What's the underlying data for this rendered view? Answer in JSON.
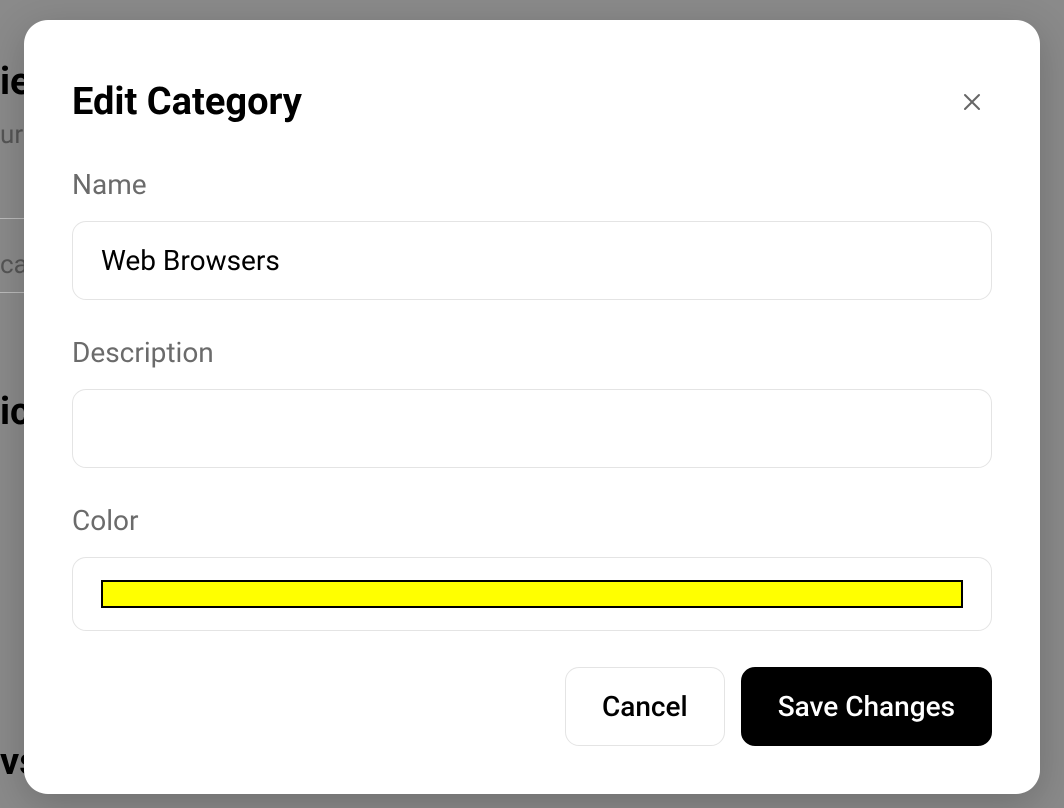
{
  "modal": {
    "title": "Edit Category",
    "labels": {
      "name": "Name",
      "description": "Description",
      "color": "Color"
    },
    "values": {
      "name": "Web Browsers",
      "description": "",
      "color": "#ffff00"
    },
    "buttons": {
      "cancel": "Cancel",
      "save": "Save Changes"
    }
  },
  "backdrop": {
    "t1": "ie",
    "t2": "ur",
    "t3": "ca",
    "t4": "ic",
    "t5": "vs"
  }
}
